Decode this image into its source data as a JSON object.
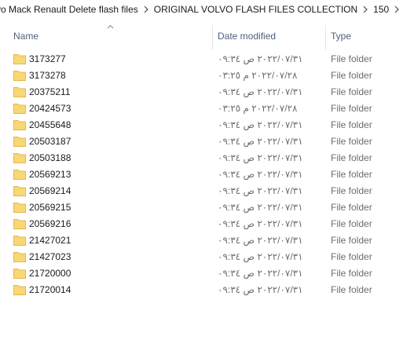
{
  "breadcrumb": {
    "items": [
      "vo Mack Renault Delete flash files",
      "ORIGINAL VOLVO FLASH FILES COLLECTION",
      "150"
    ]
  },
  "columns": {
    "name": "Name",
    "date_modified": "Date modified",
    "type": "Type",
    "sorted_by": "Name",
    "sort_direction": "ascending"
  },
  "colors": {
    "folder": "#f8d775",
    "folder_dark": "#e8b84a",
    "header_text": "#4c607a"
  },
  "files": [
    {
      "name": "3173277",
      "date": "٢٠٢٢/٠٧/٣١ ص ٠٩:٣٤",
      "type": "File folder",
      "icon": "folder-icon"
    },
    {
      "name": "3173278",
      "date": "٢٠٢٢/٠٧/٢٨ م ٠٣:٢٥",
      "type": "File folder",
      "icon": "folder-icon"
    },
    {
      "name": "20375211",
      "date": "٢٠٢٢/٠٧/٣١ ص ٠٩:٣٤",
      "type": "File folder",
      "icon": "folder-icon"
    },
    {
      "name": "20424573",
      "date": "٢٠٢٢/٠٧/٢٨ م ٠٣:٢٥",
      "type": "File folder",
      "icon": "folder-icon"
    },
    {
      "name": "20455648",
      "date": "٢٠٢٢/٠٧/٣١ ص ٠٩:٣٤",
      "type": "File folder",
      "icon": "folder-icon"
    },
    {
      "name": "20503187",
      "date": "٢٠٢٢/٠٧/٣١ ص ٠٩:٣٤",
      "type": "File folder",
      "icon": "folder-icon"
    },
    {
      "name": "20503188",
      "date": "٢٠٢٢/٠٧/٣١ ص ٠٩:٣٤",
      "type": "File folder",
      "icon": "folder-icon"
    },
    {
      "name": "20569213",
      "date": "٢٠٢٢/٠٧/٣١ ص ٠٩:٣٤",
      "type": "File folder",
      "icon": "folder-icon"
    },
    {
      "name": "20569214",
      "date": "٢٠٢٢/٠٧/٣١ ص ٠٩:٣٤",
      "type": "File folder",
      "icon": "folder-icon"
    },
    {
      "name": "20569215",
      "date": "٢٠٢٢/٠٧/٣١ ص ٠٩:٣٤",
      "type": "File folder",
      "icon": "folder-icon"
    },
    {
      "name": "20569216",
      "date": "٢٠٢٢/٠٧/٣١ ص ٠٩:٣٤",
      "type": "File folder",
      "icon": "folder-icon"
    },
    {
      "name": "21427021",
      "date": "٢٠٢٢/٠٧/٣١ ص ٠٩:٣٤",
      "type": "File folder",
      "icon": "folder-icon"
    },
    {
      "name": "21427023",
      "date": "٢٠٢٢/٠٧/٣١ ص ٠٩:٣٤",
      "type": "File folder",
      "icon": "folder-icon"
    },
    {
      "name": "21720000",
      "date": "٢٠٢٢/٠٧/٣١ ص ٠٩:٣٤",
      "type": "File folder",
      "icon": "folder-icon"
    },
    {
      "name": "21720014",
      "date": "٢٠٢٢/٠٧/٣١ ص ٠٩:٣٤",
      "type": "File folder",
      "icon": "folder-icon"
    }
  ]
}
